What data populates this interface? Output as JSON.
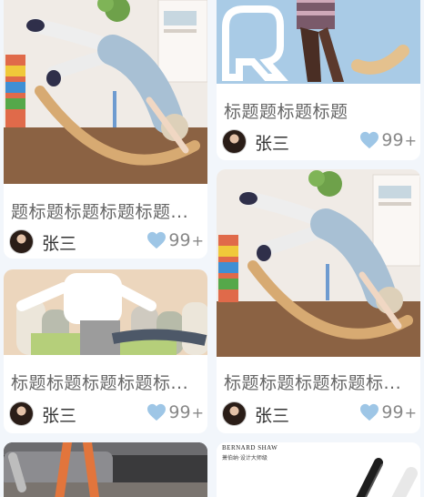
{
  "feed": {
    "cards": [
      {
        "id": "c1",
        "title": "题标题标题标题标题...",
        "author": "张三",
        "likes": "99",
        "plus": "+"
      },
      {
        "id": "c2",
        "title": "标题题标题标题",
        "author": "张三",
        "likes": "99",
        "plus": "+"
      },
      {
        "id": "c3",
        "title": "标题标题标题标题标...",
        "author": "张三",
        "likes": "99",
        "plus": "+"
      },
      {
        "id": "c4",
        "title": "标题标题标题标题标...",
        "author": "张三",
        "likes": "99",
        "plus": "+"
      }
    ],
    "card6_brand": "BERNARD SHAW",
    "card6_tagline": "萧伯纳·设计大师级",
    "accent_heart": "#9ec6e6"
  }
}
